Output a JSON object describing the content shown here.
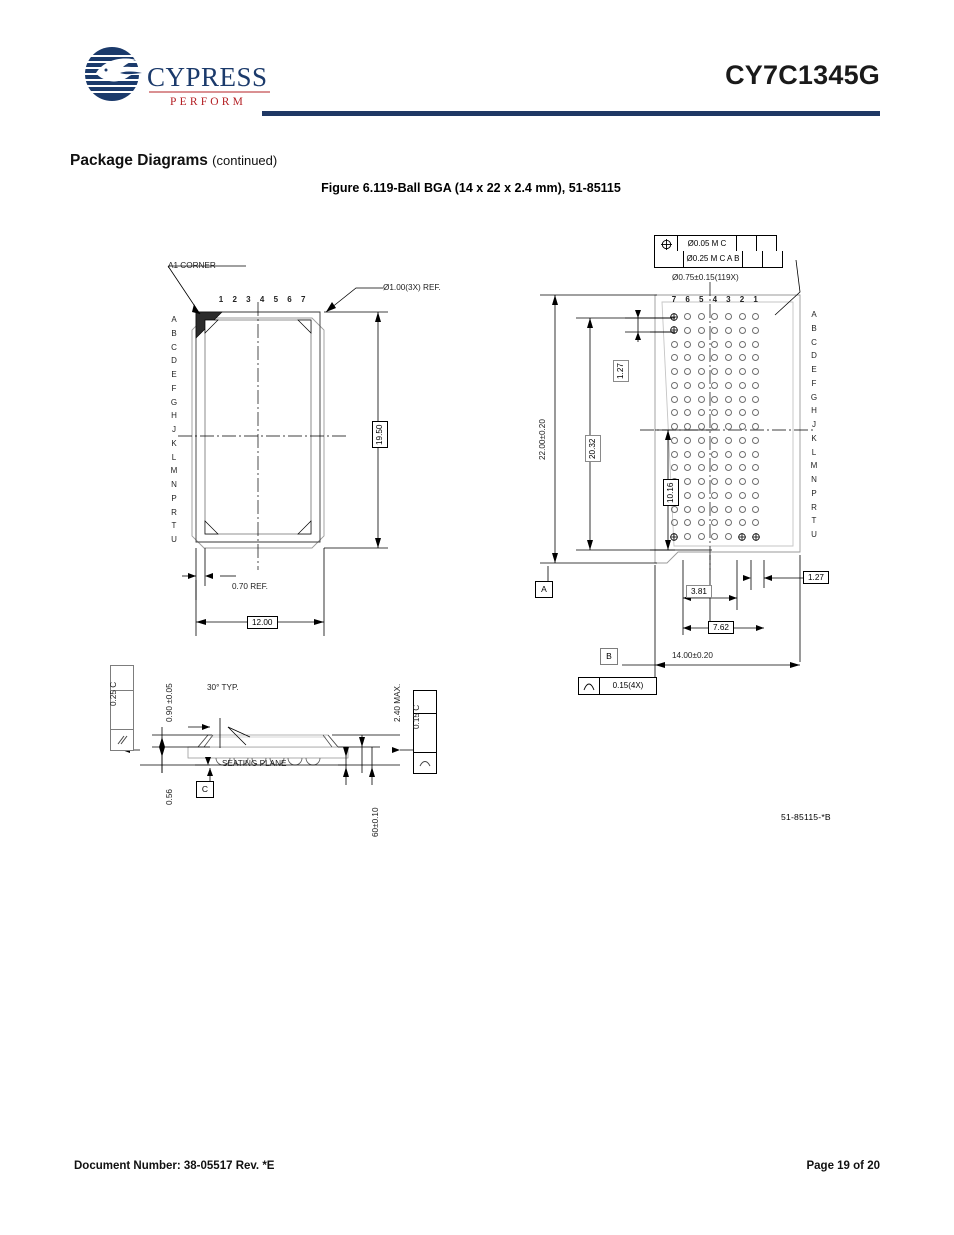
{
  "header": {
    "part_number": "CY7C1345G",
    "logo_text": "CYPRESS",
    "logo_tagline": "PERFORM"
  },
  "section": {
    "title": "Package Diagrams",
    "continued": "(continued)",
    "figure_title": "Figure 6.119-Ball BGA (14 x 22 x 2.4 mm), 51-85115"
  },
  "top_view": {
    "a1_corner_label": "A1 CORNER",
    "chamfer_note": "Ø1.00(3X) REF.",
    "columns": [
      "1",
      "2",
      "3",
      "4",
      "5",
      "6",
      "7"
    ],
    "rows": [
      "A",
      "B",
      "C",
      "D",
      "E",
      "F",
      "G",
      "H",
      "J",
      "K",
      "L",
      "M",
      "N",
      "P",
      "R",
      "T",
      "U"
    ],
    "dim_height": "19.50",
    "dim_edge": "0.70 REF.",
    "dim_width": "12.00"
  },
  "bottom_view": {
    "fcf": {
      "symbol": "position-symbol",
      "row1": "Ø0.05 M C",
      "row2": "Ø0.25 M C A B"
    },
    "ball_dia_note": "Ø0.75±0.15(119X)",
    "columns": [
      "7",
      "6",
      "5",
      "4",
      "3",
      "2",
      "1"
    ],
    "rows": [
      "A",
      "B",
      "C",
      "D",
      "E",
      "F",
      "G",
      "H",
      "J",
      "K",
      "L",
      "M",
      "N",
      "P",
      "R",
      "T",
      "U"
    ],
    "dim_body_height": "22.00±0.20",
    "dim_pitch_span_v": "20.32",
    "dim_pitch_top": "1.27",
    "dim_half_span_v": "10.16",
    "dim_pitch_right": "1.27",
    "dim_3_81": "3.81",
    "dim_7_62": "7.62",
    "dim_body_width": "14.00±0.20",
    "datum_a": "A",
    "datum_b": "B",
    "profile_note": "0.15(4X)",
    "profile_symbol": "profile-of-surface-symbol"
  },
  "side_view": {
    "parallelism_note": "0.25 C",
    "parallelism_symbol": "parallelism-symbol",
    "dim_standoff": "0.90 ±0.05",
    "angle_note": "30° TYP.",
    "dim_max_height": "2.40 MAX.",
    "flatness_note": "0.15 C",
    "flatness_symbol": "flatness-symbol",
    "seating_plane_label": "SEATING PLANE",
    "dim_ball_height": "0.56",
    "datum_c": "C",
    "dim_angle_60": "60±0.10"
  },
  "drawing_number": "51-85115-*B",
  "footer": {
    "document": "Document Number: 38-05517 Rev. *E",
    "page": "Page 19 of 20"
  },
  "colors": {
    "brand_blue": "#1f3864",
    "logo_red": "#b42025",
    "line": "#6f6f6f"
  }
}
